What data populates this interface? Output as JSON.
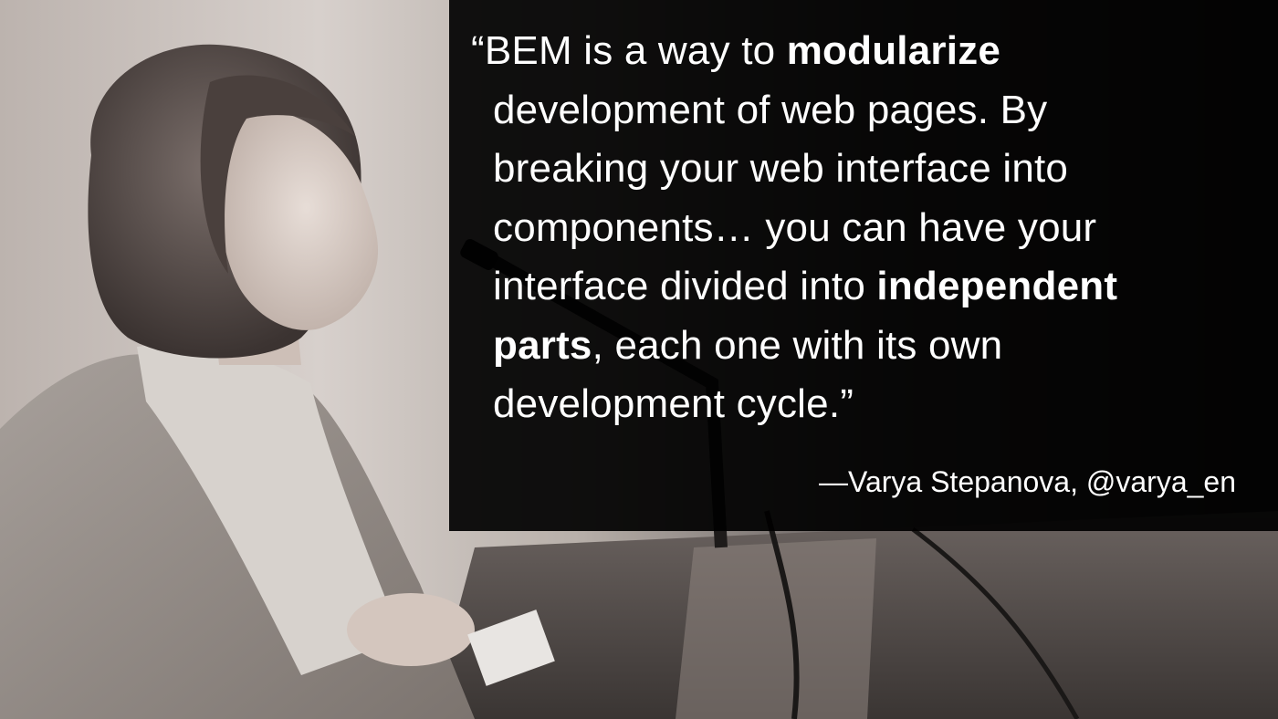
{
  "slide": {
    "quote": {
      "open_mark": "“",
      "close_mark": "”",
      "lines": [
        [
          "BEM is a way to ",
          "modularize",
          ""
        ],
        [
          "development of web pages. By",
          "",
          ""
        ],
        [
          "breaking your web interface into",
          "",
          ""
        ],
        [
          "components… you can have your",
          "",
          ""
        ],
        [
          "interface divided into ",
          "independent",
          ""
        ],
        [
          "",
          "parts",
          ", each one with its own"
        ],
        [
          "development cycle.",
          "",
          ""
        ]
      ]
    },
    "attribution": "—Varya Stepanova, @varya_en",
    "photo": {
      "subject": "speaker-at-podium-photo",
      "tone": "grayscale-warm"
    }
  },
  "colors": {
    "panel_bg": "#000000",
    "text": "#ffffff",
    "photo_light": "#d9d2cc",
    "photo_dark": "#2a2726"
  }
}
